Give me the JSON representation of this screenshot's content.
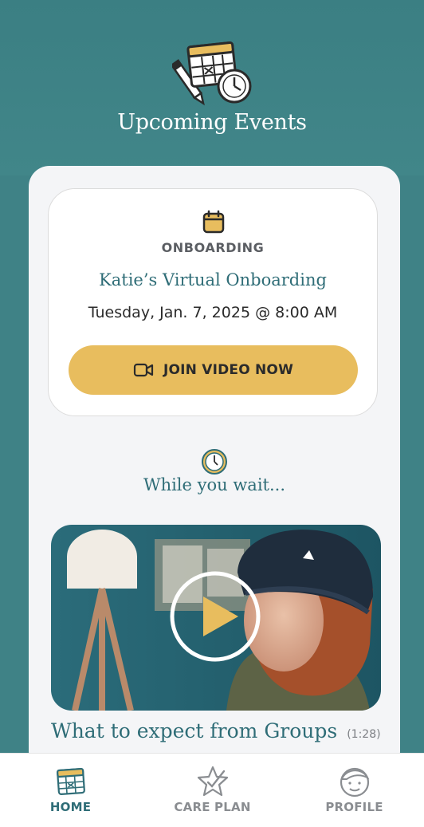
{
  "header": {
    "title": "Upcoming Events",
    "illustration": "calendar-clock-pencil-icon"
  },
  "event": {
    "type": "ONBOARDING",
    "title": "Katie’s Virtual Onboarding",
    "datetime": "Tuesday, Jan. 7, 2025 @ 8:00 AM",
    "join_label": "JOIN VIDEO NOW",
    "icon": "calendar-icon"
  },
  "waiting": {
    "title": "While you wait...",
    "icon": "clock-icon"
  },
  "video": {
    "title": "What to expect from Groups",
    "duration": "(1:28)"
  },
  "tabs": [
    {
      "label": "HOME",
      "icon": "calendar-icon",
      "active": true
    },
    {
      "label": "CARE PLAN",
      "icon": "star-check-icon",
      "active": false
    },
    {
      "label": "PROFILE",
      "icon": "face-icon",
      "active": false
    }
  ],
  "colors": {
    "teal": "#3f8286",
    "accent_gold": "#e8bd5e",
    "title_teal": "#2f6d77",
    "active_tab": "#2f6d77",
    "inactive_tab": "#8a8d91"
  }
}
